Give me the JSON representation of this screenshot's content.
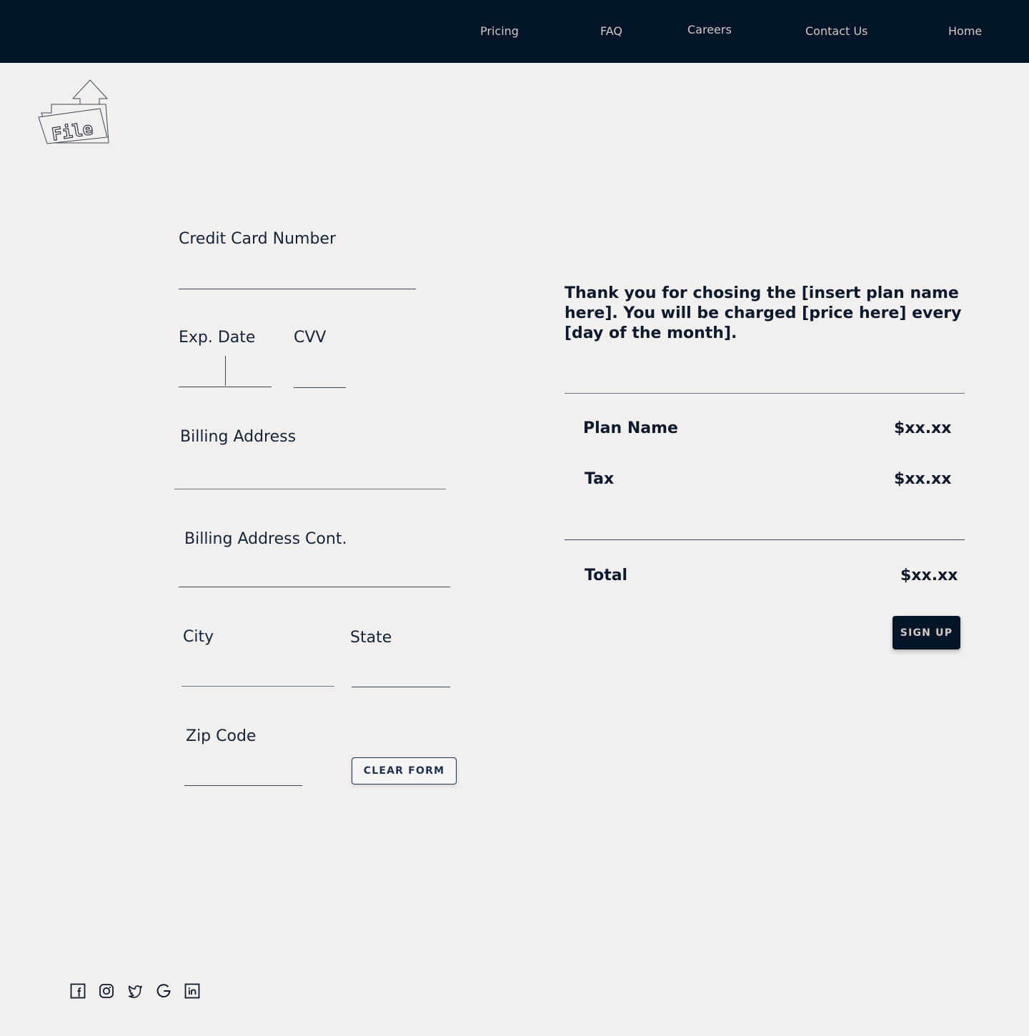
{
  "nav": {
    "items": [
      {
        "label": "Pricing"
      },
      {
        "label": "FAQ"
      },
      {
        "label": "Careers"
      },
      {
        "label": "Contact Us"
      },
      {
        "label": "Home"
      }
    ]
  },
  "logo": {
    "text": "File",
    "icon": "file-upload-logo"
  },
  "form": {
    "card_number_label": "Credit Card Number",
    "exp_date_label": "Exp. Date",
    "cvv_label": "CVV",
    "billing_address_label": "Billing Address",
    "billing_address_cont_label": "Billing Address Cont.",
    "city_label": "City",
    "state_label": "State",
    "zip_label": "Zip Code",
    "clear_button": "CLEAR FORM"
  },
  "summary": {
    "thanks_text": "Thank you for chosing the [insert plan name here]. You will be charged [price here] every [day of the month].",
    "plan_label": "Plan Name",
    "plan_price": "$xx.xx",
    "tax_label": "Tax",
    "tax_price": "$xx.xx",
    "total_label": "Total",
    "total_price": "$xx.xx",
    "signup_button": "SIGN UP"
  },
  "social": {
    "icons": [
      "facebook-icon",
      "instagram-icon",
      "twitter-icon",
      "google-icon",
      "linkedin-icon"
    ]
  },
  "colors": {
    "header_bg": "#021529",
    "nav_text": "#d6c7c2",
    "page_bg": "#f2f0ef",
    "text": "#0d1a2e"
  }
}
